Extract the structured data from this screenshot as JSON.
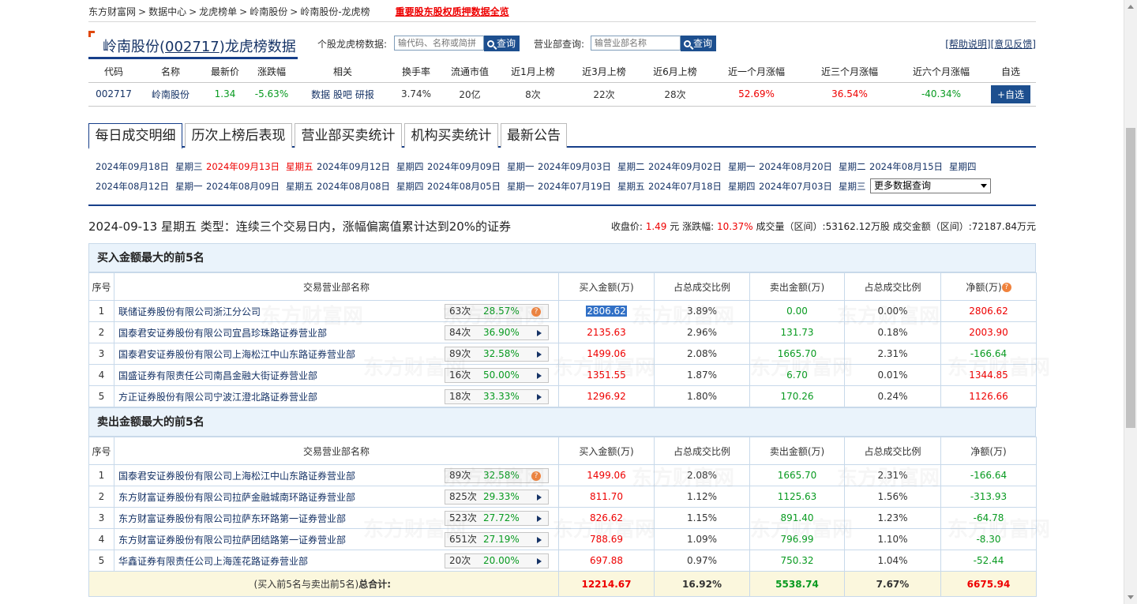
{
  "breadcrumb": {
    "items": [
      "东方财富网",
      "数据中心",
      "龙虎榜单",
      "岭南股份",
      "岭南股份-龙虎榜"
    ],
    "sep": ">",
    "hot_link": "重要股东股权质押数据全览"
  },
  "header": {
    "title_prefix": "岭南股份(",
    "title_code": "002717",
    "title_suffix": ")龙虎榜数据",
    "stock_search_label": "个股龙虎榜数据:",
    "stock_search_placeholder": "输代码、名称或简拼",
    "search_btn": "查询",
    "dept_search_label": "营业部查询:",
    "dept_search_placeholder": "输营业部名称",
    "help": "[帮助说明]",
    "feedback": "[意见反馈]"
  },
  "quote": {
    "headers": [
      "代码",
      "名称",
      "最新价",
      "涨跌幅",
      "相关",
      "换手率",
      "流通市值",
      "近1月上榜",
      "近3月上榜",
      "近6月上榜",
      "近一个月涨幅",
      "近三个月涨幅",
      "近六个月涨幅",
      "自选"
    ],
    "code": "002717",
    "name": "岭南股份",
    "price": "1.34",
    "change": "-5.63%",
    "links": [
      "数据",
      "股吧",
      "研报"
    ],
    "turnover": "3.74%",
    "float_cap": "20亿",
    "m1": "8次",
    "m3": "22次",
    "m6": "28次",
    "r1": "52.69%",
    "r3": "36.54%",
    "r6": "-40.34%",
    "add": "+自选"
  },
  "tabs": [
    "每日成交明细",
    "历次上榜后表现",
    "营业部买卖统计",
    "机构买卖统计",
    "最新公告"
  ],
  "dates": [
    {
      "d": "2024年09月18日",
      "w": "星期三"
    },
    {
      "d": "2024年09月13日",
      "w": "星期五"
    },
    {
      "d": "2024年09月12日",
      "w": "星期四"
    },
    {
      "d": "2024年09月09日",
      "w": "星期一"
    },
    {
      "d": "2024年09月03日",
      "w": "星期二"
    },
    {
      "d": "2024年09月02日",
      "w": "星期一"
    },
    {
      "d": "2024年08月20日",
      "w": "星期二"
    },
    {
      "d": "2024年08月15日",
      "w": "星期四"
    },
    {
      "d": "2024年08月12日",
      "w": "星期一"
    },
    {
      "d": "2024年08月09日",
      "w": "星期五"
    },
    {
      "d": "2024年08月08日",
      "w": "星期四"
    },
    {
      "d": "2024年08月05日",
      "w": "星期一"
    },
    {
      "d": "2024年07月19日",
      "w": "星期五"
    },
    {
      "d": "2024年07月18日",
      "w": "星期四"
    },
    {
      "d": "2024年07月03日",
      "w": "星期三"
    }
  ],
  "more_select": "更多数据查询",
  "summary": {
    "title": "2024-09-13 星期五 类型：连续三个交易日内，涨幅偏离值累计达到20%的证券",
    "close_label": "收盘价:",
    "close": "1.49",
    "close_unit": "元",
    "chg_label": "涨跌幅:",
    "chg": "10.37%",
    "vol_label": "成交量（区间）:",
    "vol": "53162.12万股",
    "amt_label": "成交金额（区间）:",
    "amt": "72187.84万元"
  },
  "buy": {
    "title": "买入金额最大的前5名",
    "headers": [
      "序号",
      "交易营业部名称",
      "买入金额(万)",
      "占总成交比例",
      "卖出金额(万)",
      "占总成交比例",
      "净额(万)"
    ],
    "rows": [
      {
        "no": "1",
        "name": "联储证券股份有限公司浙江分公司",
        "cnt": "63次",
        "pct": "28.57%",
        "buy": "2806.62",
        "bp": "3.89%",
        "sell": "0.00",
        "sp": "0.00%",
        "net": "2806.62"
      },
      {
        "no": "2",
        "name": "国泰君安证券股份有限公司宜昌珍珠路证券营业部",
        "cnt": "84次",
        "pct": "36.90%",
        "buy": "2135.63",
        "bp": "2.96%",
        "sell": "131.73",
        "sp": "0.18%",
        "net": "2003.90"
      },
      {
        "no": "3",
        "name": "国泰君安证券股份有限公司上海松江中山东路证券营业部",
        "cnt": "89次",
        "pct": "32.58%",
        "buy": "1499.06",
        "bp": "2.08%",
        "sell": "1665.70",
        "sp": "2.31%",
        "net": "-166.64"
      },
      {
        "no": "4",
        "name": "国盛证券有限责任公司南昌金融大街证券营业部",
        "cnt": "16次",
        "pct": "50.00%",
        "buy": "1351.55",
        "bp": "1.87%",
        "sell": "6.70",
        "sp": "0.01%",
        "net": "1344.85"
      },
      {
        "no": "5",
        "name": "方正证券股份有限公司宁波江澄北路证券营业部",
        "cnt": "18次",
        "pct": "33.33%",
        "buy": "1296.92",
        "bp": "1.80%",
        "sell": "170.26",
        "sp": "0.24%",
        "net": "1126.66"
      }
    ]
  },
  "sell": {
    "title": "卖出金额最大的前5名",
    "headers": [
      "序号",
      "交易营业部名称",
      "买入金额(万)",
      "占总成交比例",
      "卖出金额(万)",
      "占总成交比例",
      "净额(万)"
    ],
    "rows": [
      {
        "no": "1",
        "name": "国泰君安证券股份有限公司上海松江中山东路证券营业部",
        "cnt": "89次",
        "pct": "32.58%",
        "buy": "1499.06",
        "bp": "2.08%",
        "sell": "1665.70",
        "sp": "2.31%",
        "net": "-166.64"
      },
      {
        "no": "2",
        "name": "东方财富证券股份有限公司拉萨金融城南环路证券营业部",
        "cnt": "825次",
        "pct": "29.33%",
        "buy": "811.70",
        "bp": "1.12%",
        "sell": "1125.63",
        "sp": "1.56%",
        "net": "-313.93"
      },
      {
        "no": "3",
        "name": "东方财富证券股份有限公司拉萨东环路第一证券营业部",
        "cnt": "523次",
        "pct": "27.72%",
        "buy": "826.62",
        "bp": "1.15%",
        "sell": "891.40",
        "sp": "1.23%",
        "net": "-64.78"
      },
      {
        "no": "4",
        "name": "东方财富证券股份有限公司拉萨团结路第一证券营业部",
        "cnt": "651次",
        "pct": "27.19%",
        "buy": "788.69",
        "bp": "1.09%",
        "sell": "796.99",
        "sp": "1.10%",
        "net": "-8.30"
      },
      {
        "no": "5",
        "name": "华鑫证券有限责任公司上海莲花路证券营业部",
        "cnt": "20次",
        "pct": "20.00%",
        "buy": "697.88",
        "bp": "0.97%",
        "sell": "750.32",
        "sp": "1.04%",
        "net": "-52.44"
      }
    ],
    "total_label_pre": "(买入前5名与卖出前5名)",
    "total_label": "总合计:",
    "total_buy": "12214.67",
    "total_bp": "16.92%",
    "total_sell": "5538.74",
    "total_sp": "7.67%",
    "total_net": "6675.94"
  },
  "watermark": "东方财富网",
  "colors": {
    "accent": "#173f8a",
    "up": "#e00000",
    "down": "#089a20",
    "section_bg": "#eaf3fb"
  }
}
